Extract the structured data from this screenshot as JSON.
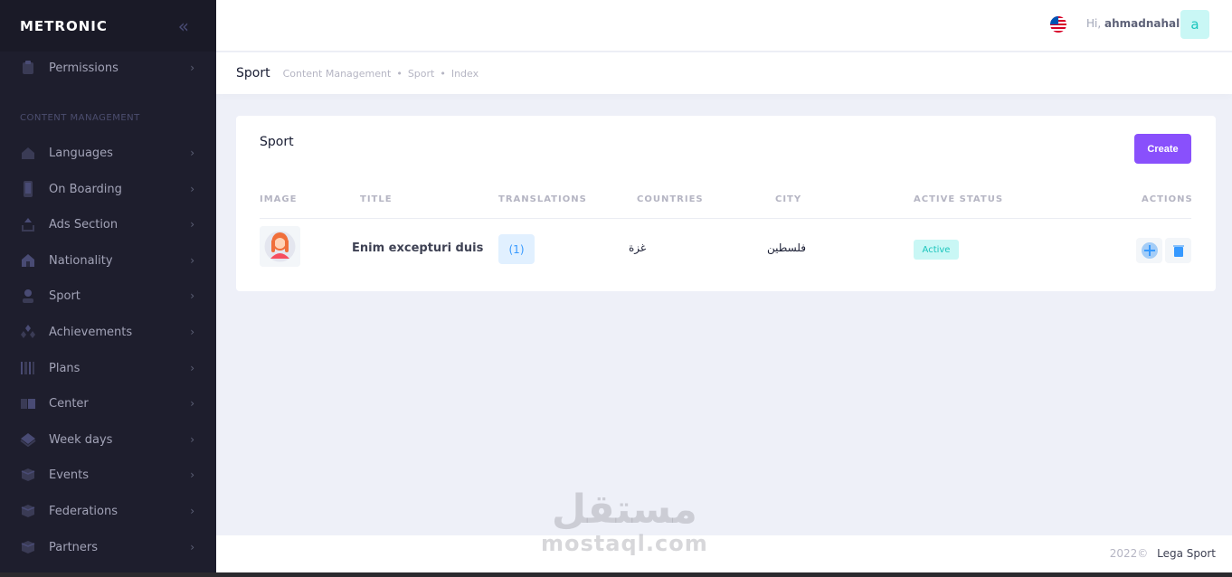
{
  "sidebar": {
    "logo": "METRONIC",
    "section_title": "CONTENT MANAGEMENT",
    "items": [
      {
        "label": "Permissions"
      },
      {
        "label": "Languages"
      },
      {
        "label": "On Boarding"
      },
      {
        "label": "Ads Section"
      },
      {
        "label": "Nationality"
      },
      {
        "label": "Sport"
      },
      {
        "label": "Achievements"
      },
      {
        "label": "Plans"
      },
      {
        "label": "Center"
      },
      {
        "label": "Week days"
      },
      {
        "label": "Events"
      },
      {
        "label": "Federations"
      },
      {
        "label": "Partners"
      }
    ]
  },
  "header": {
    "greeting_prefix": "Hi,",
    "username": "ahmadnahal",
    "avatar_letter": "a"
  },
  "subheader": {
    "title": "Sport",
    "breadcrumbs": [
      "Content Management",
      "Sport",
      "Index"
    ]
  },
  "card": {
    "title": "Sport",
    "create_label": "Create",
    "columns": [
      "IMAGE",
      "TITLE",
      "TRANSLATIONS",
      "COUNTRIES",
      "CITY",
      "ACTIVE STATUS",
      "ACTIONS"
    ],
    "rows": [
      {
        "title": "Enim excepturi duis",
        "translations": "(1)",
        "country": "غزة",
        "city": "فلسطين",
        "status": "Active"
      }
    ]
  },
  "footer": {
    "year": "2022©",
    "brand": "Lega Sport"
  },
  "watermark": {
    "arabic": "مستقل",
    "latin": "mostaql.com"
  },
  "colors": {
    "sidebar_bg": "#1e1e2d",
    "accent": "#8950fc",
    "primary_light": "#e1f0ff",
    "success_light": "#c9f7f5"
  }
}
